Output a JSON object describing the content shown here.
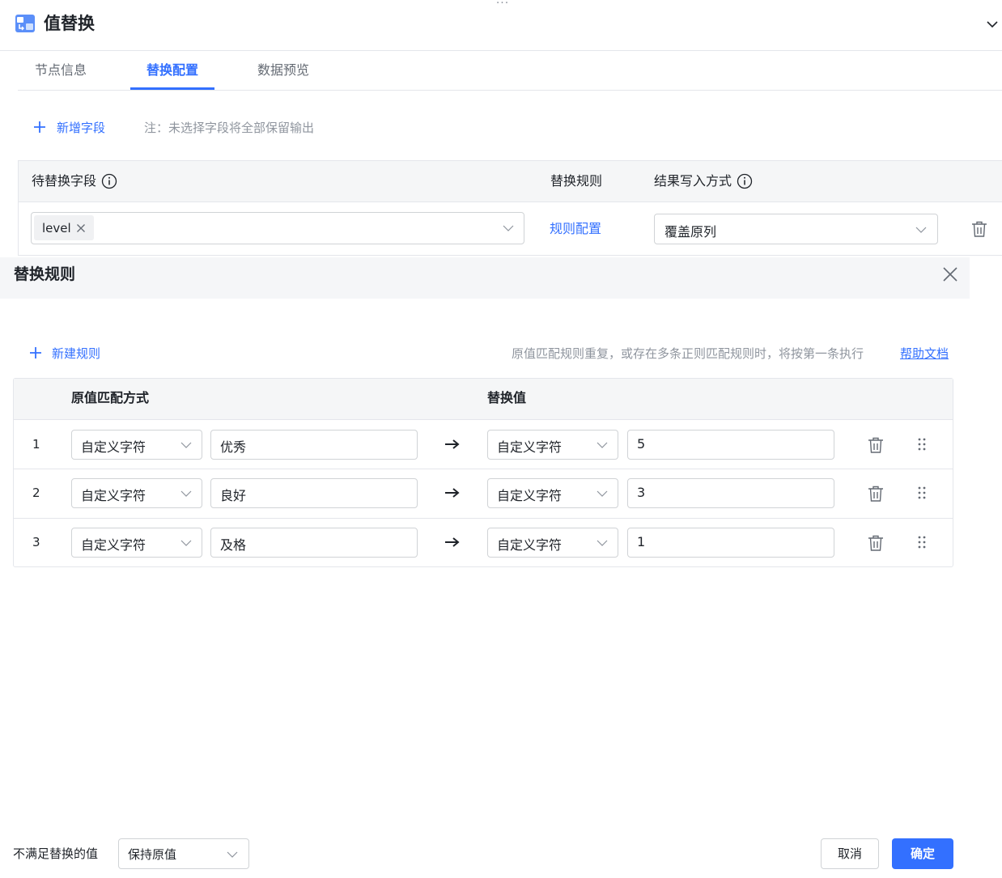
{
  "header": {
    "title": "值替换",
    "drag_handle": "···",
    "app_icon": "value-replace-icon",
    "collapse_icon": "chevron-down-icon"
  },
  "tabs": [
    {
      "label": "节点信息",
      "active": false
    },
    {
      "label": "替换配置",
      "active": true
    },
    {
      "label": "数据预览",
      "active": false
    }
  ],
  "fields": {
    "add_label": "新增字段",
    "note": "注：未选择字段将全部保留输出",
    "columns": {
      "field": "待替换字段",
      "rule": "替换规则",
      "write_mode": "结果写入方式"
    },
    "row": {
      "tag": "level",
      "rule_link": "规则配置",
      "write_mode": "覆盖原列"
    }
  },
  "drawer": {
    "title": "替换规则",
    "new_rule_label": "新建规则",
    "hint": "原值匹配规则重复，或存在多条正则匹配规则时，将按第一条执行",
    "help_link": "帮助文档",
    "columns": {
      "match": "原值匹配方式",
      "replace": "替换值"
    },
    "rules": [
      {
        "index": "1",
        "match_type": "自定义字符",
        "match_value": "优秀",
        "replace_type": "自定义字符",
        "replace_value": "5"
      },
      {
        "index": "2",
        "match_type": "自定义字符",
        "match_value": "良好",
        "replace_type": "自定义字符",
        "replace_value": "3"
      },
      {
        "index": "3",
        "match_type": "自定义字符",
        "match_value": "及格",
        "replace_type": "自定义字符",
        "replace_value": "1"
      }
    ]
  },
  "footer": {
    "unmatched_label": "不满足替换的值",
    "unmatched_value": "保持原值",
    "cancel_label": "取消",
    "ok_label": "确定"
  },
  "colors": {
    "accent": "#3370ff",
    "border": "#d0d3d6",
    "header_bg": "#f5f6f7",
    "muted_text": "#8f959e"
  }
}
